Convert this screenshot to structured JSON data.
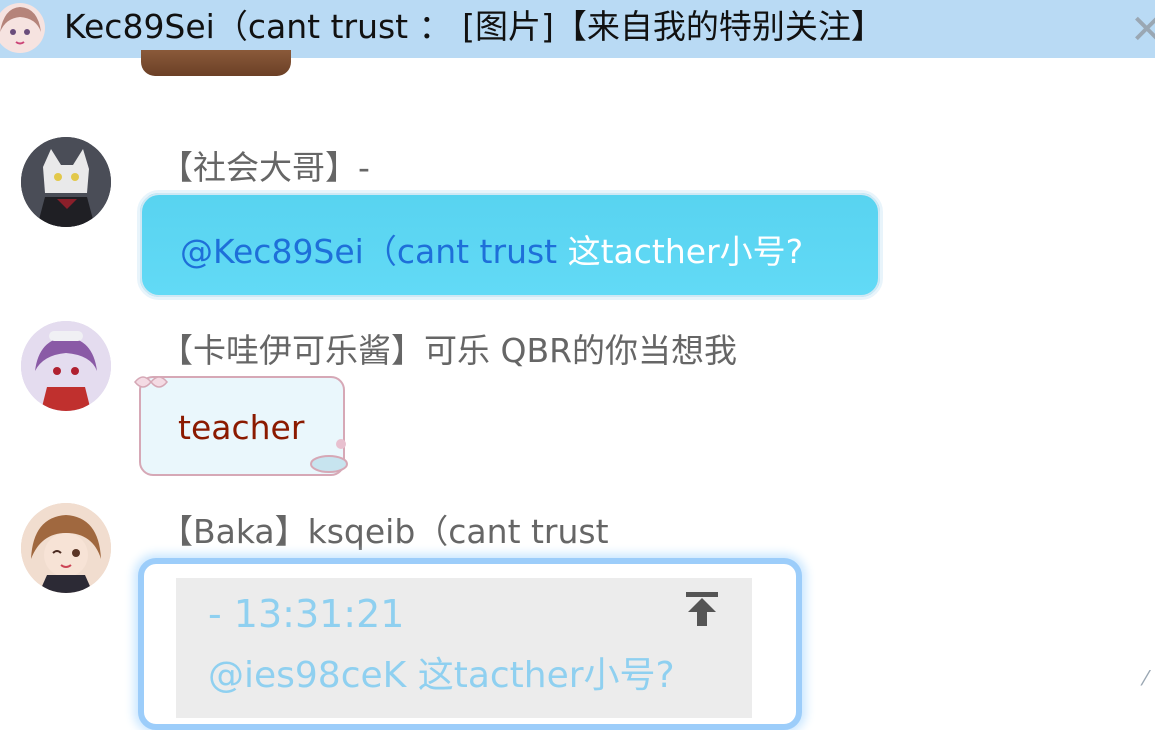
{
  "notification": {
    "title": "Kec89Sei（cant trust ： [图片]【来自我的特别关注】",
    "close_glyph": "✕"
  },
  "messages": [
    {
      "sender": "【社会大哥】-",
      "mention": "@Kec89Sei（cant trust",
      "text": " 这tacther小号?"
    },
    {
      "sender": "【卡哇伊可乐酱】可乐     QBR的你当想我",
      "text": "teacher"
    },
    {
      "sender": "【Baka】ksqeib（cant trust",
      "quote": {
        "meta": "-    13:31:21",
        "text": "@ies98ceK 这tacther小号?"
      }
    }
  ],
  "colors": {
    "topbar": "#b9daf4",
    "bubble_cyan": "#58d3f0",
    "mention_blue": "#1e6fd9",
    "teacher_text": "#8b1a00",
    "quote_text": "#8fd0f0"
  }
}
